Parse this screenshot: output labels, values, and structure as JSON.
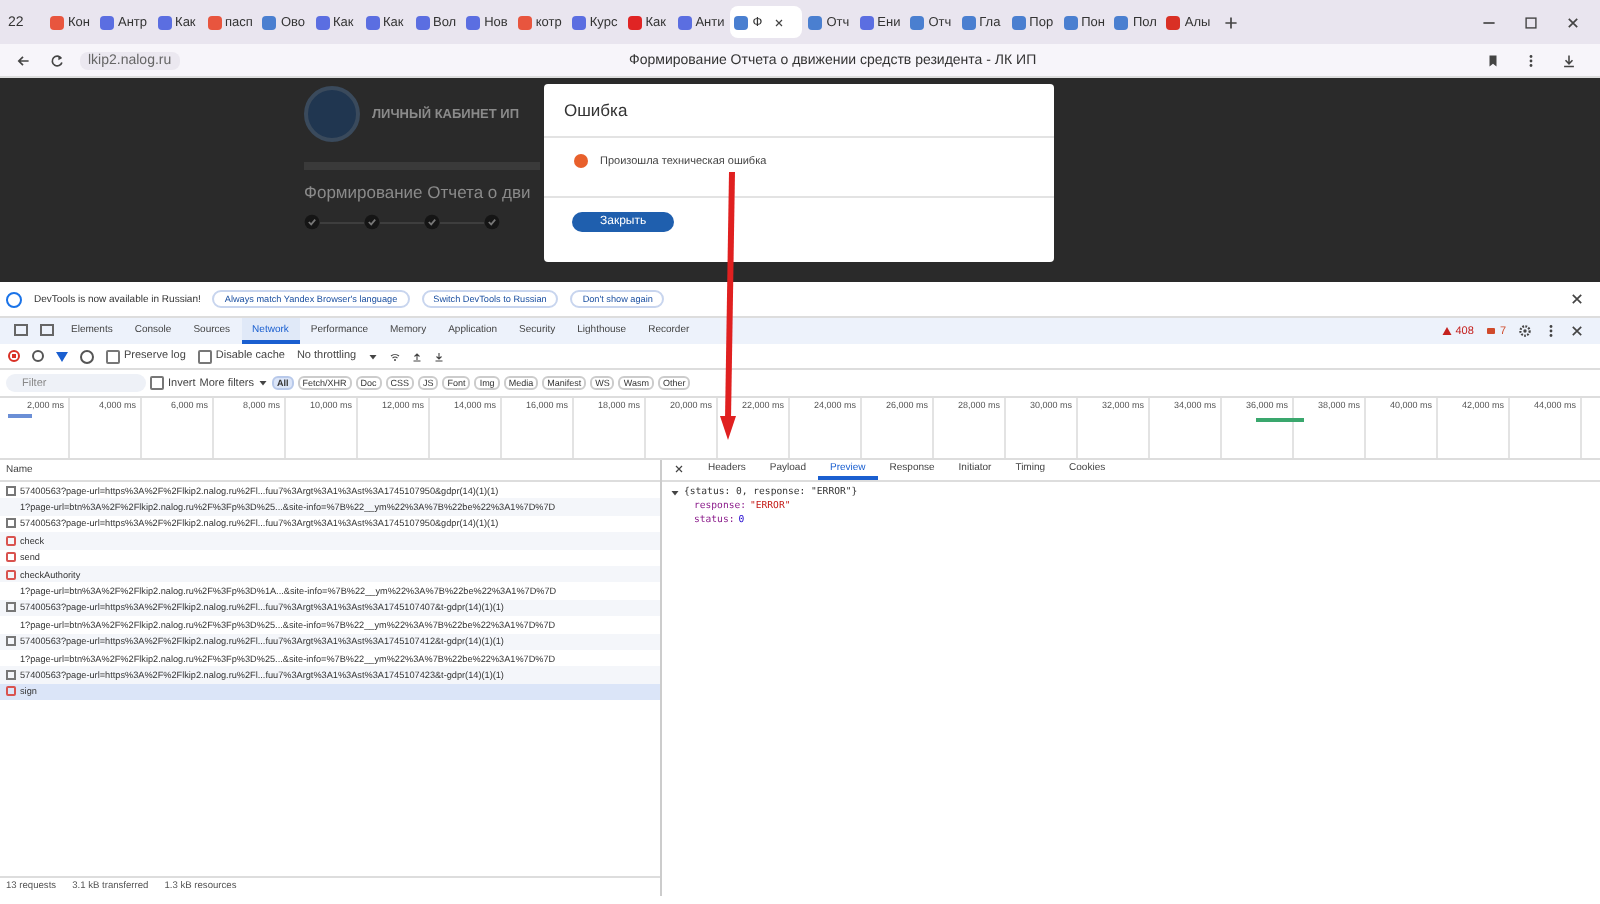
{
  "browser": {
    "tab_count": "22",
    "tabs": [
      {
        "label": "Кон",
        "selected": false,
        "color": "#e8553e"
      },
      {
        "label": "Антр",
        "selected": false,
        "color": "#5b6ee1"
      },
      {
        "label": "Как",
        "selected": false,
        "color": "#5b6ee1"
      },
      {
        "label": "пасп",
        "selected": false,
        "color": "#e8553e"
      },
      {
        "label": "Ово",
        "selected": false,
        "color": "#4a7fd0"
      },
      {
        "label": "Как",
        "selected": false,
        "color": "#5b6ee1"
      },
      {
        "label": "Как",
        "selected": false,
        "color": "#5b6ee1"
      },
      {
        "label": "Вол",
        "selected": false,
        "color": "#5b6ee1"
      },
      {
        "label": "Нов",
        "selected": false,
        "color": "#5b6ee1"
      },
      {
        "label": "котр",
        "selected": false,
        "color": "#e8553e"
      },
      {
        "label": "Курс",
        "selected": false,
        "color": "#5b6ee1"
      },
      {
        "label": "Как",
        "selected": false,
        "color": "#e02424"
      },
      {
        "label": "Анти",
        "selected": false,
        "color": "#5b6ee1"
      },
      {
        "label": "Ф",
        "selected": true,
        "color": "#4a7fd0"
      },
      {
        "label": "Отч",
        "selected": false,
        "color": "#4a7fd0"
      },
      {
        "label": "Ени",
        "selected": false,
        "color": "#5b6ee1"
      },
      {
        "label": "Отч",
        "selected": false,
        "color": "#4a7fd0"
      },
      {
        "label": "Гла",
        "selected": false,
        "color": "#4a7fd0"
      },
      {
        "label": "Пор",
        "selected": false,
        "color": "#4a7fd0"
      },
      {
        "label": "Пон",
        "selected": false,
        "color": "#4a7fd0"
      },
      {
        "label": "Пол",
        "selected": false,
        "color": "#4a7fd0"
      },
      {
        "label": "Алы",
        "selected": false,
        "color": "#d93025"
      }
    ],
    "url": "lkip2.nalog.ru",
    "page_title": "Формирование Отчета о движении средств резидента - ЛК ИП"
  },
  "page": {
    "site_title": "ЛИЧНЫЙ КАБИНЕТ ИП",
    "heading": "Формирование Отчета о дви",
    "steps": [
      {
        "done": true
      },
      {
        "done": true
      },
      {
        "done": true
      },
      {
        "done": true
      }
    ]
  },
  "dialog": {
    "title": "Ошибка",
    "message": "Произошла техническая ошибка",
    "button": "Закрыть"
  },
  "devtools": {
    "banner": {
      "message": "DevTools is now available in Russian!",
      "buttons": [
        "Always match Yandex Browser's language",
        "Switch DevTools to Russian",
        "Don't show again"
      ]
    },
    "tabs": [
      {
        "label": "Elements",
        "selected": false
      },
      {
        "label": "Console",
        "selected": false
      },
      {
        "label": "Sources",
        "selected": false
      },
      {
        "label": "Network",
        "selected": true
      },
      {
        "label": "Performance",
        "selected": false
      },
      {
        "label": "Memory",
        "selected": false
      },
      {
        "label": "Application",
        "selected": false
      },
      {
        "label": "Security",
        "selected": false
      },
      {
        "label": "Lighthouse",
        "selected": false
      },
      {
        "label": "Recorder",
        "selected": false
      }
    ],
    "warnings": "408",
    "errors": "7",
    "toolbar": {
      "preserve_log": {
        "label": "Preserve log",
        "checked": false
      },
      "disable_cache": {
        "label": "Disable cache",
        "checked": false
      },
      "throttling": "No throttling"
    },
    "filter": {
      "placeholder": "Filter",
      "invert": {
        "label": "Invert",
        "checked": false
      },
      "more_filters": "More filters",
      "types": [
        {
          "label": "All",
          "selected": true
        },
        {
          "label": "Fetch/XHR",
          "selected": false
        },
        {
          "label": "Doc",
          "selected": false
        },
        {
          "label": "CSS",
          "selected": false
        },
        {
          "label": "JS",
          "selected": false
        },
        {
          "label": "Font",
          "selected": false
        },
        {
          "label": "Img",
          "selected": false
        },
        {
          "label": "Media",
          "selected": false
        },
        {
          "label": "Manifest",
          "selected": false
        },
        {
          "label": "WS",
          "selected": false
        },
        {
          "label": "Wasm",
          "selected": false
        },
        {
          "label": "Other",
          "selected": false
        }
      ]
    },
    "timeline_ticks": [
      "2,000 ms",
      "4,000 ms",
      "6,000 ms",
      "8,000 ms",
      "10,000 ms",
      "12,000 ms",
      "14,000 ms",
      "16,000 ms",
      "18,000 ms",
      "20,000 ms",
      "22,000 ms",
      "24,000 ms",
      "26,000 ms",
      "28,000 ms",
      "30,000 ms",
      "32,000 ms",
      "34,000 ms",
      "36,000 ms",
      "38,000 ms",
      "40,000 ms",
      "42,000 ms",
      "44,000 ms"
    ],
    "requests": {
      "column": "Name",
      "rows": [
        {
          "name": "57400563?page-url=https%3A%2F%2Flkip2.nalog.ru%2Fl...fuu7%3Argt%3A1%3Ast%3A1745107950&gdpr(14)(1)(1)",
          "kind": "doc",
          "selected": false
        },
        {
          "name": "1?page-url=btn%3A%2F%2Flkip2.nalog.ru%2F%3Fp%3D%25...&site-info=%7B%22__ym%22%3A%7B%22be%22%3A1%7D%7D",
          "kind": "ping",
          "selected": false
        },
        {
          "name": "57400563?page-url=https%3A%2F%2Flkip2.nalog.ru%2Fl...fuu7%3Argt%3A1%3Ast%3A1745107950&gdpr(14)(1)(1)",
          "kind": "doc",
          "selected": false
        },
        {
          "name": "check",
          "kind": "xhr",
          "selected": false
        },
        {
          "name": "send",
          "kind": "xhr",
          "selected": false
        },
        {
          "name": "checkAuthority",
          "kind": "xhr",
          "selected": false
        },
        {
          "name": "1?page-url=btn%3A%2F%2Flkip2.nalog.ru%2F%3Fp%3D%1A...&site-info=%7B%22__ym%22%3A%7B%22be%22%3A1%7D%7D",
          "kind": "ping",
          "selected": false
        },
        {
          "name": "57400563?page-url=https%3A%2F%2Flkip2.nalog.ru%2Fl...fuu7%3Argt%3A1%3Ast%3A1745107407&t-gdpr(14)(1)(1)",
          "kind": "doc",
          "selected": false
        },
        {
          "name": "1?page-url=btn%3A%2F%2Flkip2.nalog.ru%2F%3Fp%3D%25...&site-info=%7B%22__ym%22%3A%7B%22be%22%3A1%7D%7D",
          "kind": "ping",
          "selected": false
        },
        {
          "name": "57400563?page-url=https%3A%2F%2Flkip2.nalog.ru%2Fl...fuu7%3Argt%3A1%3Ast%3A1745107412&t-gdpr(14)(1)(1)",
          "kind": "doc",
          "selected": false
        },
        {
          "name": "1?page-url=btn%3A%2F%2Flkip2.nalog.ru%2F%3Fp%3D%25...&site-info=%7B%22__ym%22%3A%7B%22be%22%3A1%7D%7D",
          "kind": "ping",
          "selected": false
        },
        {
          "name": "57400563?page-url=https%3A%2F%2Flkip2.nalog.ru%2Fl...fuu7%3Argt%3A1%3Ast%3A1745107423&t-gdpr(14)(1)(1)",
          "kind": "doc",
          "selected": false
        },
        {
          "name": "sign",
          "kind": "xhr",
          "selected": true
        }
      ]
    },
    "summary": [
      "13 requests",
      "3.1 kB transferred",
      "1.3 kB resources"
    ],
    "detail_tabs": [
      {
        "label": "Headers",
        "selected": false
      },
      {
        "label": "Payload",
        "selected": false
      },
      {
        "label": "Preview",
        "selected": true
      },
      {
        "label": "Response",
        "selected": false
      },
      {
        "label": "Initiator",
        "selected": false
      },
      {
        "label": "Timing",
        "selected": false
      },
      {
        "label": "Cookies",
        "selected": false
      }
    ],
    "preview": {
      "summary": "{status: 0, response: \"ERROR\"}",
      "fields": [
        {
          "key": "response:",
          "value": "\"ERROR\"",
          "kind": "string"
        },
        {
          "key": "status:",
          "value": "0",
          "kind": "number"
        }
      ]
    }
  }
}
